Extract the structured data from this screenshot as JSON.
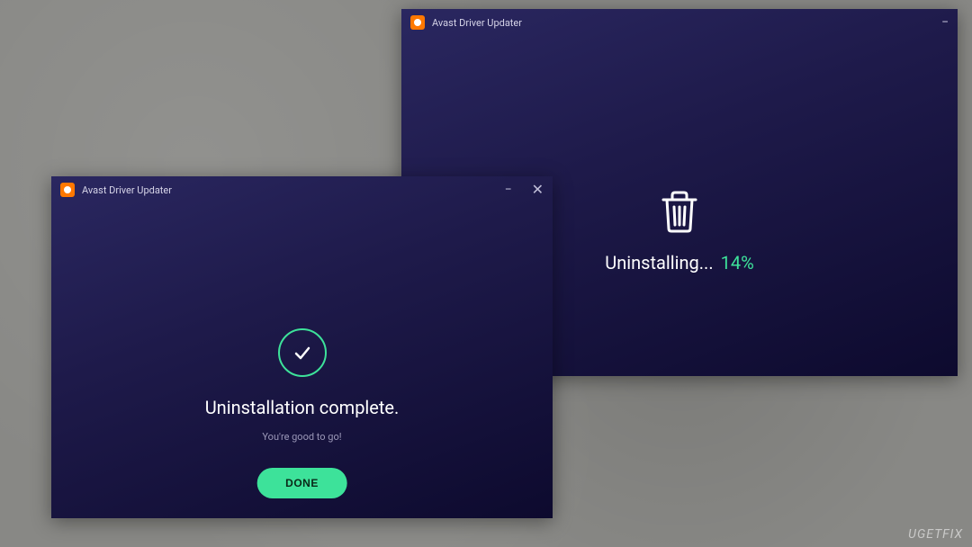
{
  "background_window": {
    "title": "Avast Driver Updater",
    "status_label": "Uninstalling...",
    "progress_percent": "14%"
  },
  "foreground_window": {
    "title": "Avast Driver Updater",
    "headline": "Uninstallation complete.",
    "subtext": "You're good to go!",
    "done_button": "DONE"
  },
  "icons": {
    "logo": "avast-logo-icon",
    "minimize": "−",
    "close": "✕",
    "trash": "trash-icon",
    "check": "check-icon"
  },
  "colors": {
    "accent_green": "#3de29a",
    "window_bg_start": "#2a2760",
    "window_bg_end": "#0d0a2e",
    "logo_orange": "#ff7800"
  },
  "watermark": "UGETFIX"
}
